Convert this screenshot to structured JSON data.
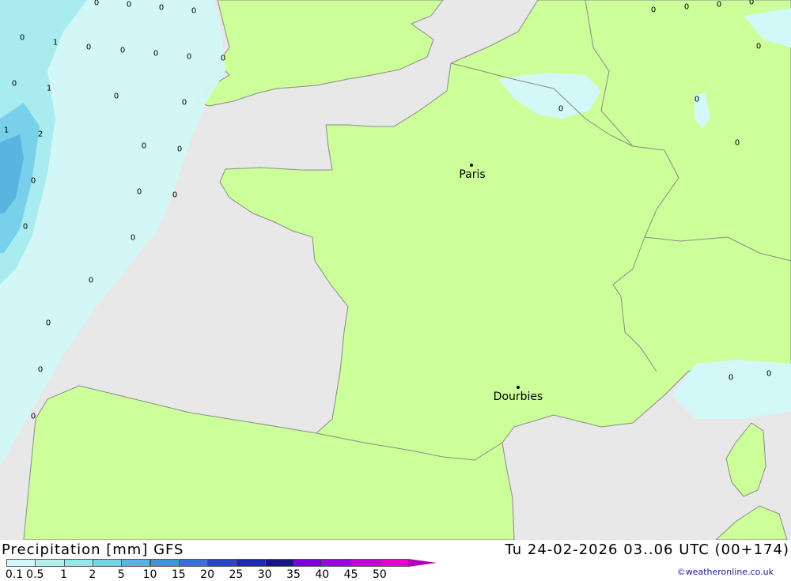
{
  "map": {
    "title": "Precipitation [mm] GFS",
    "valid_time": "Tu 24-02-2026 03..06 UTC (00+174)",
    "credit": "©weatheronline.co.uk",
    "cities": [
      {
        "name": "Paris"
      },
      {
        "name": "Dourbies"
      }
    ],
    "point_values": [
      "0",
      "0",
      "0",
      "0",
      "1",
      "0",
      "0",
      "0",
      "0",
      "0",
      "0",
      "1",
      "0",
      "0",
      "1",
      "2",
      "0",
      "0",
      "0",
      "0",
      "0",
      "0",
      "0",
      "0",
      "0",
      "0",
      "0",
      "0",
      "0",
      "0",
      "0",
      "0",
      "0",
      "0",
      "0",
      "0"
    ],
    "legend": {
      "ticks": [
        "0.1",
        "0.5",
        "1",
        "2",
        "5",
        "10",
        "15",
        "20",
        "25",
        "30",
        "35",
        "40",
        "45",
        "50"
      ],
      "colors": [
        "#d2f8f8",
        "#b4f0f0",
        "#96e6ea",
        "#78d4e4",
        "#5ab4e0",
        "#3c96dc",
        "#3c6ee0",
        "#2846c8",
        "#1e28b4",
        "#14148c",
        "#7800dc",
        "#a000e6",
        "#c800dc",
        "#e600d2",
        "#b400b4"
      ]
    },
    "colors": {
      "sea": "#e8e8e8",
      "land": "#ccff99",
      "precip_light": "#d2f8f8",
      "precip_mid": "#9ee6ee",
      "precip_high": "#5ab4e0",
      "border": "#8a8a8a"
    }
  }
}
